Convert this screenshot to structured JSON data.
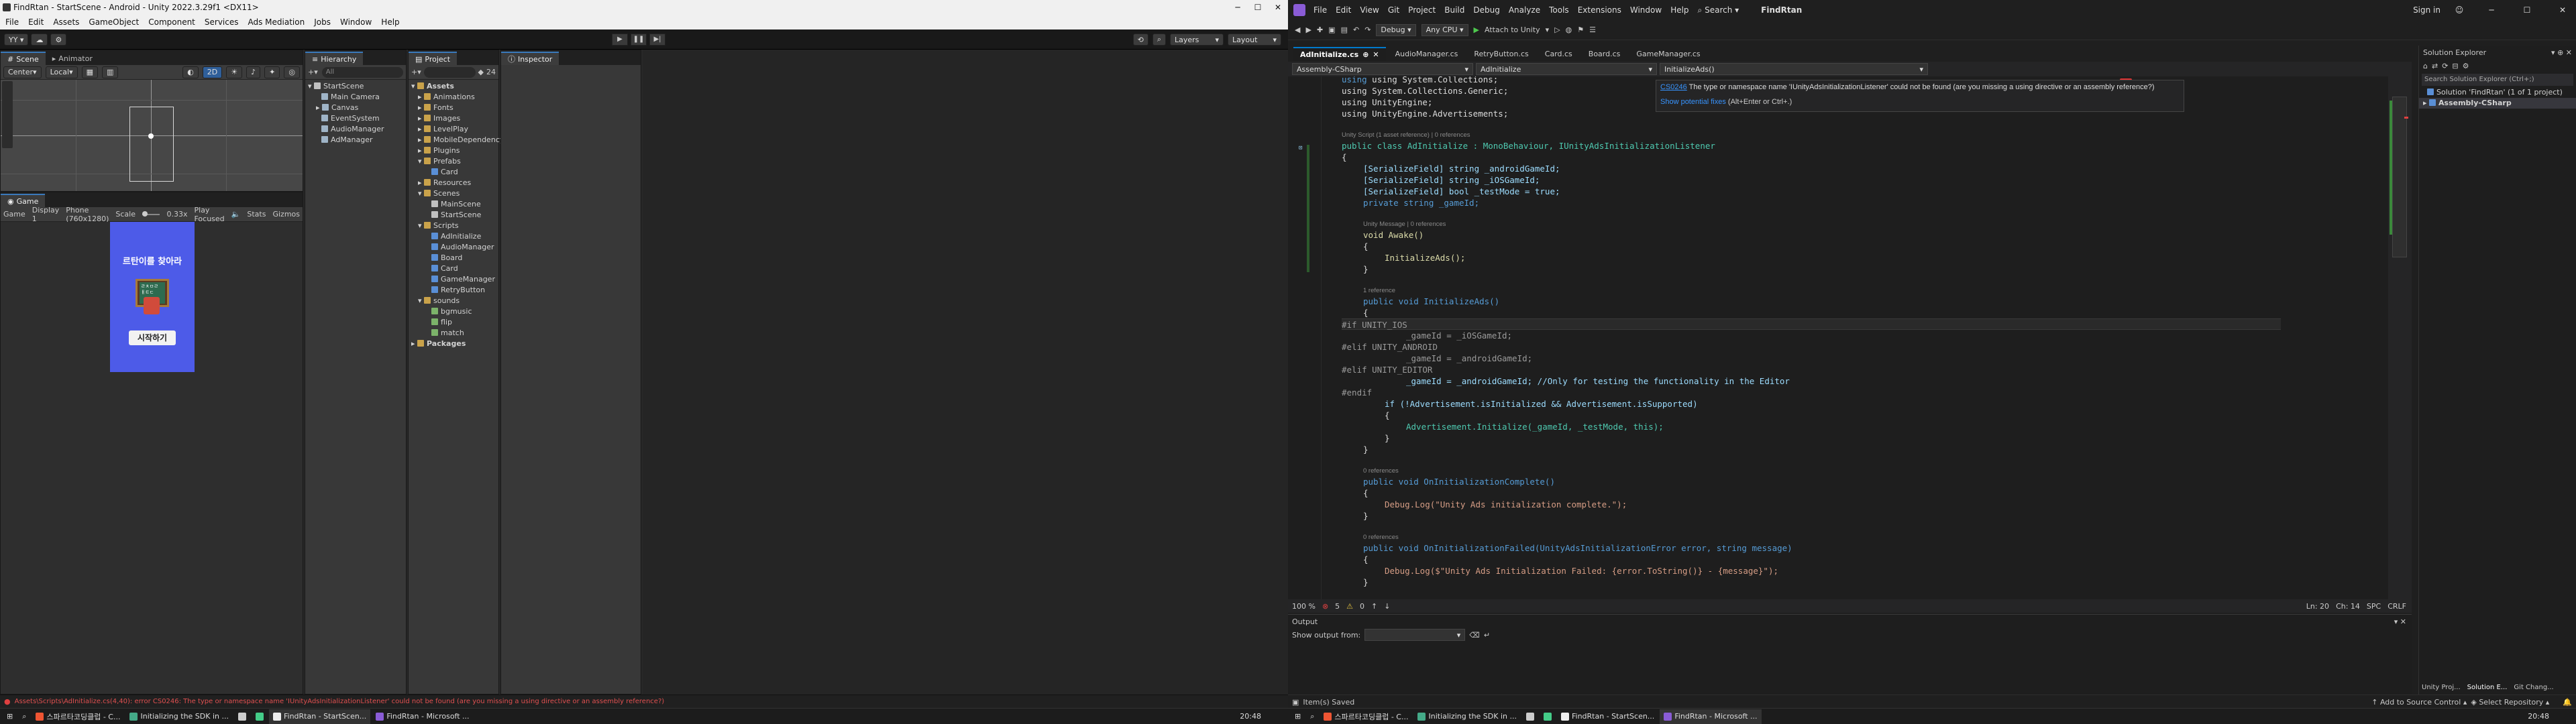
{
  "unity": {
    "window_title": "FindRtan - StartScene - Android - Unity 2022.3.29f1 <DX11>",
    "menu": [
      "File",
      "Edit",
      "Assets",
      "GameObject",
      "Component",
      "Services",
      "Ads Mediation",
      "Jobs",
      "Window",
      "Help"
    ],
    "toolbar": {
      "layers_label": "Layers",
      "layout_label": "Layout"
    },
    "scene_tabs": {
      "scene": "Scene",
      "animator": "Animator"
    },
    "scene_toolbar": {
      "pivot": "Center",
      "space": "Local",
      "mode_2d": "2D"
    },
    "game": {
      "tab": "Game",
      "display_mode": "Game",
      "display": "Display 1",
      "resolution": "Phone (760x1280)",
      "scale_label": "Scale",
      "scale_value": "0.33x",
      "play_focused": "Play Focused",
      "stats": "Stats",
      "gizmos": "Gizmos",
      "phone_title": "르탄이를 찾아라",
      "start_button": "시작하기",
      "character_board_text": "ㄹㅊㅁㄹ\nㅐㅌㄷ"
    },
    "hierarchy": {
      "tab": "Hierarchy",
      "search_placeholder": "All",
      "scene_name": "StartScene",
      "items": [
        "Main Camera",
        "Canvas",
        "EventSystem",
        "AudioManager",
        "AdManager"
      ]
    },
    "project": {
      "tab": "Project",
      "count_badge": "24",
      "root": "Assets",
      "folders": [
        "Animations",
        "Fonts",
        "Images",
        "LevelPlay",
        "MobileDependencyResolver",
        "Plugins"
      ],
      "prefabs": {
        "name": "Prefabs",
        "children": [
          "Card"
        ]
      },
      "resources": "Resources",
      "scenes": {
        "name": "Scenes",
        "children": [
          "MainScene",
          "StartScene"
        ]
      },
      "scripts": {
        "name": "Scripts",
        "children": [
          "AdInitialize",
          "AudioManager",
          "Board",
          "Card",
          "GameManager",
          "RetryButton"
        ]
      },
      "sounds": {
        "name": "sounds",
        "children": [
          "bgmusic",
          "flip",
          "match"
        ]
      },
      "packages": "Packages"
    },
    "inspector": {
      "tab": "Inspector"
    },
    "status_error": "Assets\\Scripts\\AdInitialize.cs(4,40): error CS0246: The type or namespace name 'IUnityAdsInitializationListener' could not be found (are you missing a using directive or an assembly reference?)",
    "taskbar": {
      "items": [
        "스파르타코딩클럽 - C...",
        "Initializing the SDK in ...",
        "",
        "",
        "FindRtan - StartScen...",
        "FindRtan - Microsoft ..."
      ],
      "time": "20:48"
    }
  },
  "vs": {
    "menu": [
      "File",
      "Edit",
      "View",
      "Git",
      "Project",
      "Build",
      "Debug",
      "Analyze",
      "Tools",
      "Extensions",
      "Window",
      "Help"
    ],
    "search_label": "Search",
    "solution_name": "FindRtan",
    "sign_in": "Sign in",
    "toolbar": {
      "config": "Debug",
      "platform": "Any CPU",
      "attach": "Attach to Unity"
    },
    "tabs": [
      "AdInitialize.cs",
      "AudioManager.cs",
      "RetryButton.cs",
      "Card.cs",
      "Board.cs",
      "GameManager.cs"
    ],
    "nav": {
      "project": "Assembly-CSharp",
      "class": "AdInitialize",
      "member": "InitializeAds()"
    },
    "code": {
      "using_collections": "using System.Collections;",
      "using_generic": "using System.Collections.Generic;",
      "using_engine": "using UnityEngine;",
      "using_ads": "using UnityEngine.Advertisements;",
      "lens_class": "Unity Script (1 asset reference) | 0 references",
      "class_decl": "public class AdInitialize : MonoBehaviour, IUnityAdsInitializationListener",
      "brace_open": "{",
      "field1": "[SerializeField] string _androidGameId;",
      "field2": "[SerializeField] string _iOSGameId;",
      "field3": "[SerializeField] bool _testMode = true;",
      "field4": "private string _gameId;",
      "lens_awake": "Unity Message | 0 references",
      "awake": "void Awake()",
      "call_init": "InitializeAds();",
      "lens_init": "1 reference",
      "init_decl": "public void InitializeAds()",
      "if_ios": "#if UNITY_IOS",
      "ios_assign": "_gameId = _iOSGameId;",
      "elif_android": "#elif UNITY_ANDROID",
      "android_assign": "_gameId = _androidGameId;",
      "elif_editor": "#elif UNITY_EDITOR",
      "editor_assign": "_gameId = _androidGameId; //Only for testing the functionality in the Editor",
      "endif": "#endif",
      "if_check": "if (!Advertisement.isInitialized && Advertisement.isSupported)",
      "adv_init": "Advertisement.Initialize(_gameId, _testMode, this);",
      "lens_complete": "0 references",
      "complete_decl": "public void OnInitializationComplete()",
      "complete_log": "Debug.Log(\"Unity Ads initialization complete.\");",
      "lens_failed": "0 references",
      "failed_decl": "public void OnInitializationFailed(UnityAdsInitializationError error, string message)",
      "failed_log": "Debug.Log($\"Unity Ads Initialization Failed: {error.ToString()} - {message}\");",
      "brace_close": "}"
    },
    "tooltip": {
      "code": "CS0246",
      "message": "The type or namespace name 'IUnityAdsInitializationListener' could not be found (are you missing a using directive or an assembly reference?)",
      "fix_link": "Show potential fixes",
      "fix_shortcut": "(Alt+Enter or Ctrl+.)"
    },
    "editor_status": {
      "zoom": "100 %",
      "errors": "5",
      "warnings": "0",
      "line": "Ln: 20",
      "col": "Ch: 14",
      "spc": "SPC",
      "crlf": "CRLF"
    },
    "output": {
      "title": "Output",
      "show_from": "Show output from:"
    },
    "solution_explorer": {
      "title": "Solution Explorer",
      "search": "Search Solution Explorer (Ctrl+;)",
      "solution": "Solution 'FindRtan' (1 of 1 project)",
      "project": "Assembly-CSharp",
      "bottom_tabs": [
        "Unity Proj...",
        "Solution E...",
        "Git Chang..."
      ]
    },
    "statusbar": {
      "saved": "Item(s) Saved",
      "source_control": "Add to Source Control",
      "repo": "Select Repository"
    },
    "taskbar": {
      "items": [
        "스파르타코딩클럽 - C...",
        "Initializing the SDK in ...",
        "",
        "",
        "FindRtan - StartScen...",
        "FindRtan - Microsoft ..."
      ],
      "time": "20:48"
    }
  }
}
